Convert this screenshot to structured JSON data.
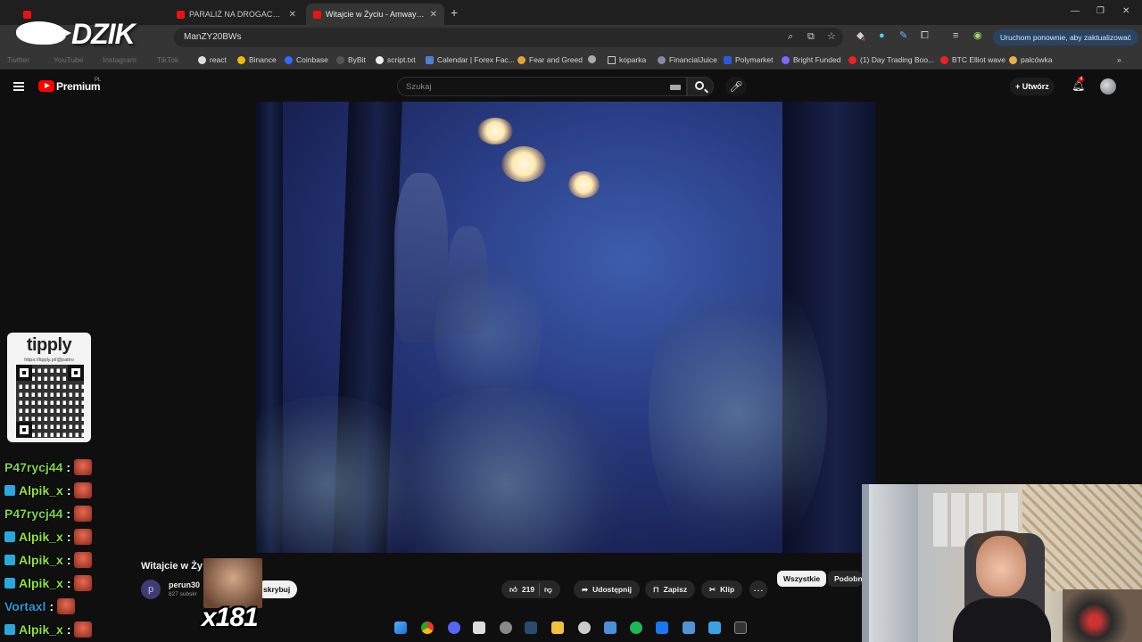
{
  "browser": {
    "tabs": [
      {
        "label": "",
        "active": false
      },
      {
        "label": "PARALIŻ NA DROGACH. ATAK Z...",
        "active": false
      },
      {
        "label": "Witajcie w Życiu - Amway - You",
        "active": true
      }
    ],
    "url": "ManZY20BWs",
    "update_button": "Uruchom ponownie, aby zaktualizować",
    "extension_badge": "4",
    "bookmarks": [
      "Twitter",
      "YouTube",
      "Instagram",
      "TikTok",
      "react",
      "Binance",
      "Coinbase",
      "ByBit",
      "script.txt",
      "Calendar | Forex Fac...",
      "Fear and Greed",
      "",
      "koparka",
      "FinancialJuice",
      "Polymarket",
      "Bright Funded",
      "(1) Day Trading Boo...",
      "BTC Elliot wave",
      "palcówka"
    ]
  },
  "overlay": {
    "logo_text": "DZIK",
    "tippy_name": "tipply",
    "tippy_link": "https://tipply.pl/@patiro",
    "meme_count": "x181",
    "chat": [
      {
        "user": "P47rycj44",
        "color": "#7cd34a",
        "badge": false
      },
      {
        "user": "Alpik_x",
        "color": "#8fe23c",
        "badge": true
      },
      {
        "user": "P47rycj44",
        "color": "#7cd34a",
        "badge": false
      },
      {
        "user": "Alpik_x",
        "color": "#8fe23c",
        "badge": true
      },
      {
        "user": "Alpik_x",
        "color": "#8fe23c",
        "badge": true
      },
      {
        "user": "Alpik_x",
        "color": "#8fe23c",
        "badge": true
      },
      {
        "user": "Vortaxl",
        "color": "#2a9ad6",
        "badge": false
      },
      {
        "user": "Alpik_x",
        "color": "#8fe23c",
        "badge": true
      }
    ]
  },
  "youtube": {
    "brand": "Premium",
    "region": "PL",
    "search_placeholder": "Szukaj",
    "create_label": "Utwórz",
    "notifications": "4",
    "video_title": "Witajcie w Ży",
    "channel_initial": "p",
    "channel_name": "perun30",
    "channel_subs": "827 subskr",
    "subscribe_label": "skrybuj",
    "likes": "219",
    "share_label": "Udostępnij",
    "save_label": "Zapisz",
    "clip_label": "Klip",
    "chips": [
      "Wszystkie",
      "Podobne"
    ]
  },
  "colors": {
    "accent": "#ff0000",
    "update_btn": "#294463"
  }
}
